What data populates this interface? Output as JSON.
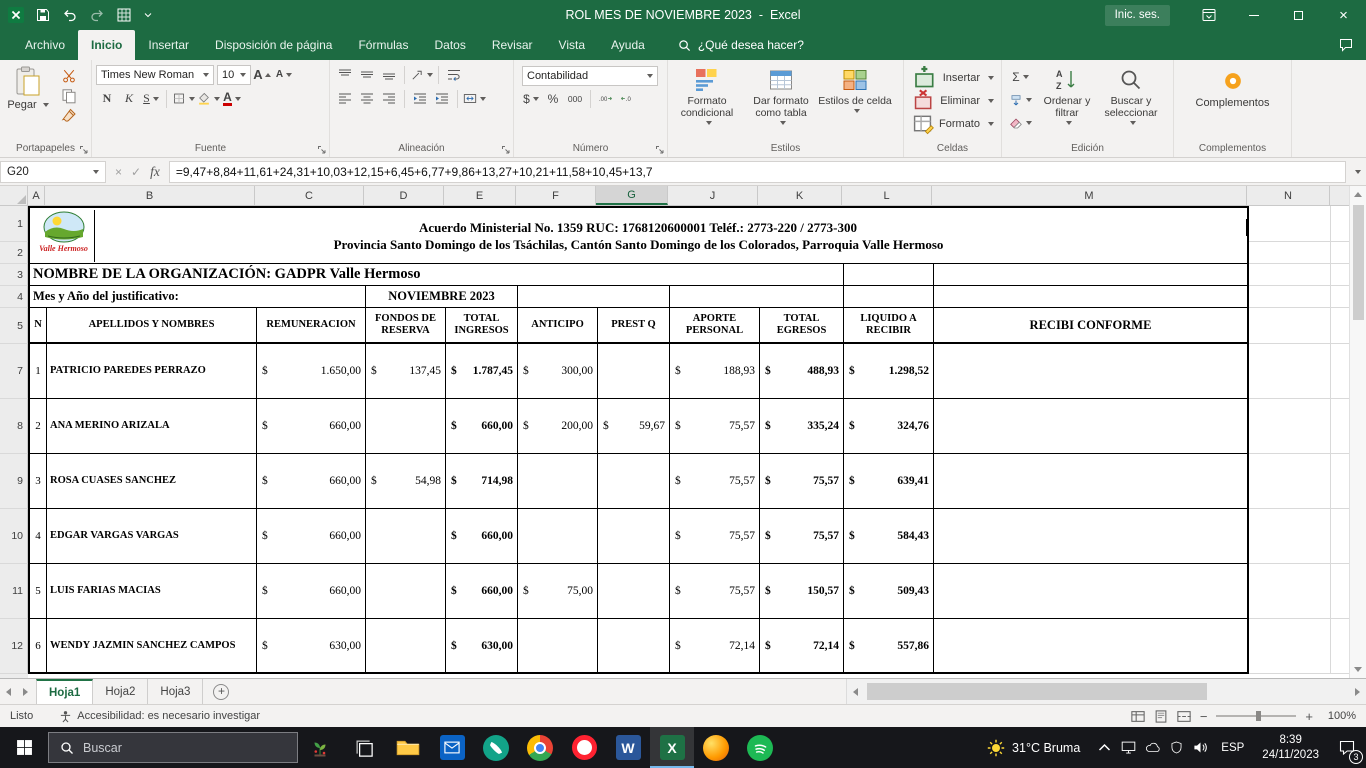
{
  "colors": {
    "excel_green": "#217346",
    "window_chrome": "#1d6b42",
    "ribbon_bg": "#f3f2f1",
    "taskbar_bg": "#16171b",
    "grid_line": "#d9d9d9"
  },
  "title_bar": {
    "title": "ROL MES DE NOVIEMBRE 2023  -  Excel",
    "sign_in_label": "Inic. ses."
  },
  "ribbon_tabs": {
    "items": [
      "Archivo",
      "Inicio",
      "Insertar",
      "Disposición de página",
      "Fórmulas",
      "Datos",
      "Revisar",
      "Vista",
      "Ayuda"
    ],
    "active": "Inicio",
    "search_label": "¿Qué desea hacer?"
  },
  "ribbon": {
    "paste_label": "Pegar",
    "font_name": "Times New Roman",
    "font_size": "10",
    "number_format": "Contabilidad",
    "glyphs": {
      "bold": "N",
      "italic": "K",
      "underline": "S",
      "font_letter": "A",
      "currency": "$",
      "percent": "%",
      "thousands": "000",
      "autosum": "Σ",
      "fx": "fx"
    },
    "style_buttons": [
      "Formato condicional",
      "Dar formato como tabla",
      "Estilos de celda"
    ],
    "cells_buttons": [
      "Insertar",
      "Eliminar",
      "Formato"
    ],
    "editing_buttons": [
      "Ordenar y filtrar",
      "Buscar y seleccionar"
    ],
    "addins_button": "Complementos",
    "group_labels": {
      "clipboard": "Portapapeles",
      "font": "Fuente",
      "alignment": "Alineación",
      "number": "Número",
      "styles": "Estilos",
      "cells": "Celdas",
      "editing": "Edición",
      "addins": "Complementos"
    }
  },
  "formula_bar": {
    "name_box": "G20",
    "formula": "=9,47+8,84+11,61+24,31+10,03+12,15+6,45+6,77+9,86+13,27+10,21+11,58+10,45+13,7"
  },
  "sheet": {
    "columns": [
      "A",
      "B",
      "C",
      "D",
      "E",
      "F",
      "G",
      "J",
      "K",
      "L",
      "M",
      "N"
    ],
    "selected_column": "G",
    "row_numbers": [
      "1",
      "2",
      "3",
      "4",
      "5",
      "7",
      "8",
      "9",
      "10",
      "11",
      "12"
    ],
    "logo_caption": "Valle Hermoso",
    "title_line1": "Acuerdo Ministerial No. 1359 RUC: 1768120600001 Teléf.: 2773-220 / 2773-300",
    "title_line2": "Provincia Santo Domingo de los Tsáchilas, Cantón Santo Domingo de los Colorados, Parroquia Valle Hermoso",
    "org_line": "NOMBRE DE LA ORGANIZACIÓN: GADPR Valle Hermoso",
    "period_label": "Mes y Año del justificativo:",
    "period_value": "NOVIEMBRE 2023",
    "table": {
      "currency": "$",
      "headers": [
        "N",
        "APELLIDOS Y NOMBRES",
        "REMUNERACION",
        "FONDOS DE RESERVA",
        "TOTAL INGRESOS",
        "ANTICIPO",
        "PREST Q",
        "APORTE PERSONAL",
        "TOTAL EGRESOS",
        "LIQUIDO A RECIBIR",
        "RECIBI CONFORME"
      ],
      "rows": [
        {
          "n": "1",
          "name": "PATRICIO PAREDES PERRAZO",
          "remuneracion": "1.650,00",
          "fondos": "137,45",
          "ingresos": "1.787,45",
          "anticipo": "300,00",
          "prest": "",
          "aporte": "188,93",
          "egresos": "488,93",
          "liquido": "1.298,52",
          "recibi": ""
        },
        {
          "n": "2",
          "name": "ANA MERINO ARIZALA",
          "remuneracion": "660,00",
          "fondos": "",
          "ingresos": "660,00",
          "anticipo": "200,00",
          "prest": "59,67",
          "aporte": "75,57",
          "egresos": "335,24",
          "liquido": "324,76",
          "recibi": ""
        },
        {
          "n": "3",
          "name": "ROSA CUASES SANCHEZ",
          "remuneracion": "660,00",
          "fondos": "54,98",
          "ingresos": "714,98",
          "anticipo": "",
          "prest": "",
          "aporte": "75,57",
          "egresos": "75,57",
          "liquido": "639,41",
          "recibi": ""
        },
        {
          "n": "4",
          "name": "EDGAR VARGAS VARGAS",
          "remuneracion": "660,00",
          "fondos": "",
          "ingresos": "660,00",
          "anticipo": "",
          "prest": "",
          "aporte": "75,57",
          "egresos": "75,57",
          "liquido": "584,43",
          "recibi": ""
        },
        {
          "n": "5",
          "name": "LUIS FARIAS MACIAS",
          "remuneracion": "660,00",
          "fondos": "",
          "ingresos": "660,00",
          "anticipo": "75,00",
          "prest": "",
          "aporte": "75,57",
          "egresos": "150,57",
          "liquido": "509,43",
          "recibi": ""
        },
        {
          "n": "6",
          "name": "WENDY JAZMIN SANCHEZ CAMPOS",
          "remuneracion": "630,00",
          "fondos": "",
          "ingresos": "630,00",
          "anticipo": "",
          "prest": "",
          "aporte": "72,14",
          "egresos": "72,14",
          "liquido": "557,86",
          "recibi": ""
        }
      ]
    }
  },
  "sheet_tabs": {
    "tabs": [
      "Hoja1",
      "Hoja2",
      "Hoja3"
    ],
    "active": "Hoja1"
  },
  "status_bar": {
    "mode": "Listo",
    "accessibility": "Accesibilidad: es necesario investigar",
    "zoom_level": "100%"
  },
  "taskbar": {
    "search_placeholder": "Buscar",
    "pinned_apps": [
      "plant",
      "task-view",
      "file-explorer",
      "mail",
      "whatsapp",
      "chrome",
      "opera",
      "word",
      "excel",
      "firefox",
      "spotify"
    ],
    "active_app": "excel",
    "app_glyphs": {
      "word": "W",
      "excel": "X"
    },
    "weather": "31°C Bruma",
    "tray_icons": [
      "hidden-icons-chevron",
      "monitor",
      "onedrive-cloud",
      "security-shield",
      "volume"
    ],
    "language": "ESP",
    "time": "8:39",
    "date": "24/11/2023",
    "notification_count": "3"
  },
  "ui_glyphs": {
    "close": "×",
    "cancel": "×",
    "enter": "✓",
    "zoom_out": "−",
    "zoom_in": "+",
    "new_sheet": "+"
  }
}
